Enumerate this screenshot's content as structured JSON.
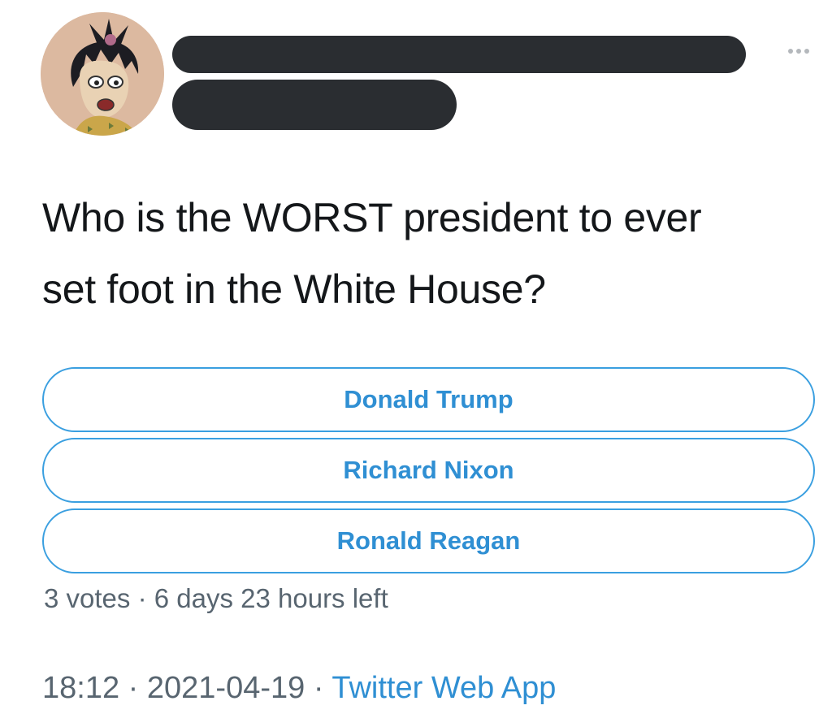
{
  "tweet": {
    "text": "Who is the WORST president to ever\nset foot in the White House?",
    "more_icon": "more-horizontal-icon"
  },
  "poll": {
    "options": [
      {
        "label": "Donald Trump"
      },
      {
        "label": "Richard Nixon"
      },
      {
        "label": "Ronald Reagan"
      }
    ],
    "votes": "3 votes",
    "separator": " · ",
    "time_left": "6 days 23 hours left"
  },
  "footer": {
    "time": "18:12",
    "date": "2021-04-19",
    "separator": " · ",
    "source": "Twitter Web App"
  },
  "colors": {
    "accent": "#2f8fd3",
    "option_border": "#3a9fe0",
    "text": "#14171a",
    "secondary_text": "#586570",
    "redaction": "#2a2d31"
  }
}
